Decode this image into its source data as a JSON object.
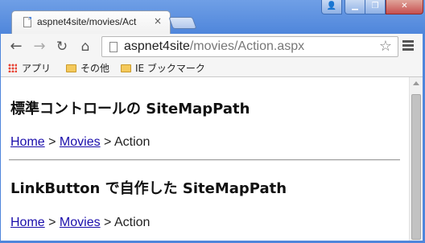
{
  "tab": {
    "title": "aspnet4site/movies/Act",
    "close": "×"
  },
  "window_controls": {
    "user": "👤",
    "minimize": "▁",
    "maximize": "❐",
    "close": "✕"
  },
  "toolbar": {
    "back": "←",
    "forward": "→",
    "reload": "↻",
    "home": "⌂",
    "url_host": "aspnet4site",
    "url_path": "/movies/Action.aspx",
    "star": "☆"
  },
  "bookmarks": {
    "apps": "アプリ",
    "other": "その他",
    "ie": "IE ブックマーク"
  },
  "page": {
    "section1": {
      "heading": "標準コントロールの SiteMapPath",
      "crumbs": {
        "home": "Home",
        "sep1": " > ",
        "movies": "Movies",
        "sep2": " > ",
        "current": "Action"
      }
    },
    "section2": {
      "heading": "LinkButton で自作した SiteMapPath",
      "crumbs": {
        "home": "Home",
        "sep1": " > ",
        "movies": "Movies",
        "sep2": " > ",
        "current": "Action"
      }
    }
  },
  "colors": {
    "link": "#1a0dab",
    "chrome_blue": "#4f86db"
  }
}
